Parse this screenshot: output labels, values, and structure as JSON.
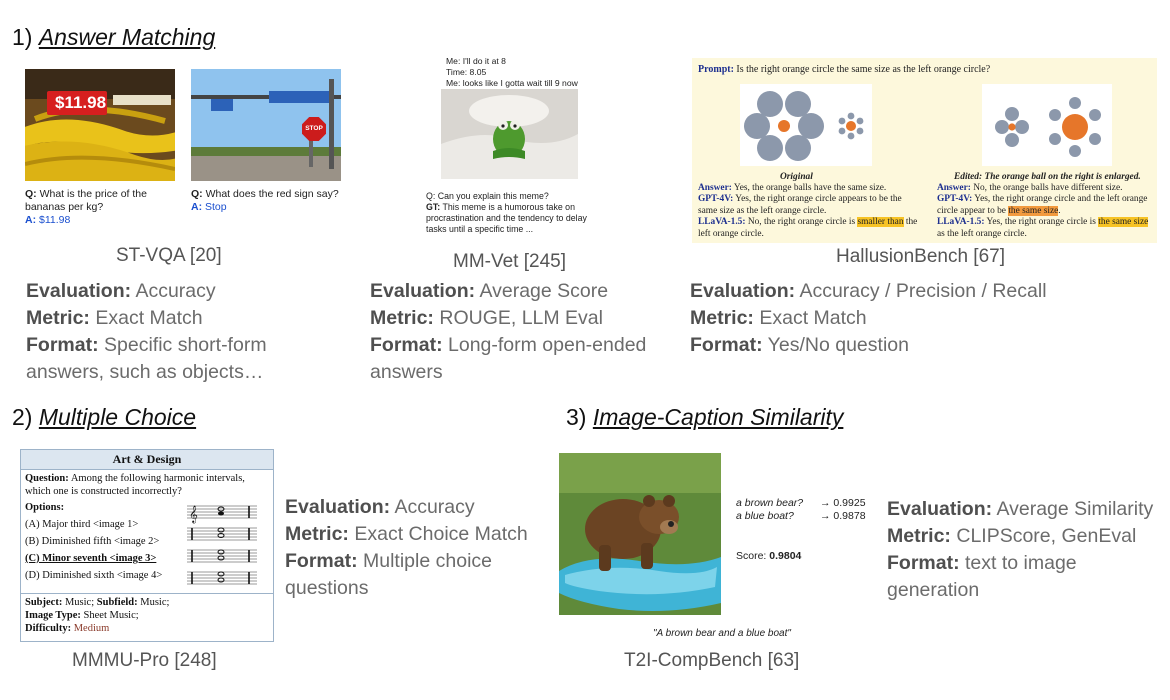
{
  "sections": {
    "s1": {
      "num": "1)",
      "label": "Answer Matching"
    },
    "s2": {
      "num": "2)",
      "label": "Multiple Choice"
    },
    "s3": {
      "num": "3)",
      "label": "Image-Caption Similarity"
    }
  },
  "stvqa": {
    "price_tag": "$11.98",
    "sign_text": "STOP",
    "q1": {
      "q_label": "Q:",
      "q": "What is the price of the bananas per kg?",
      "a_label": "A:",
      "a": "$11.98"
    },
    "q2": {
      "q_label": "Q:",
      "q": "What does the red sign say?",
      "a_label": "A:",
      "a": "Stop"
    },
    "caption": "ST-VQA [20]",
    "eval": {
      "label": "Evaluation:",
      "value": "Accuracy"
    },
    "metric": {
      "label": "Metric:",
      "value": "Exact Match"
    },
    "format": {
      "label": "Format:",
      "value": "Specific short-form answers, such as objects…"
    }
  },
  "mmvet": {
    "me1": "Me: I'll do it at 8",
    "time": "Time: 8.05",
    "me2": "Me: looks like I gotta wait till 9 now",
    "q": "Q: Can you explain this meme?",
    "gt_label": "GT:",
    "gt": "This meme is a humorous take on procrastination and the tendency to delay tasks until a specific time ...",
    "caption": "MM-Vet [245]",
    "eval": {
      "label": "Evaluation:",
      "value": "Average Score"
    },
    "metric": {
      "label": "Metric:",
      "value": "ROUGE, LLM Eval"
    },
    "format": {
      "label": "Format:",
      "value": "Long-form open-ended answers"
    }
  },
  "hallusion": {
    "prompt_label": "Prompt:",
    "prompt": "Is the right orange circle the same size as the left orange circle?",
    "orig_title": "Original",
    "edit_title": "Edited: The orange ball on the right is enlarged.",
    "left": {
      "answer_label": "Answer:",
      "answer": "Yes, the orange balls have the same size.",
      "gpt_label": "GPT-4V:",
      "gpt": "Yes, the right orange circle appears to be the same size as the left orange circle.",
      "llava_label": "LLaVA-1.5:",
      "llava_a": "No, the right orange circle is",
      "llava_hl": "smaller than",
      "llava_b": "the left orange circle."
    },
    "right": {
      "answer_label": "Answer:",
      "answer": "No, the orange balls have different size.",
      "gpt_label": "GPT-4V:",
      "gpt_a": "Yes, the right orange circle and the left orange circle appear to be",
      "gpt_hl": "the same size",
      "gpt_b": ".",
      "llava_label": "LLaVA-1.5:",
      "llava_a": "Yes, the right orange circle is",
      "llava_hl": "the same size",
      "llava_b": "as the left orange circle."
    },
    "caption": "HallusionBench [67]",
    "eval": {
      "label": "Evaluation:",
      "value": "Accuracy / Precision / Recall"
    },
    "metric": {
      "label": "Metric:",
      "value": "Exact Match"
    },
    "format": {
      "label": "Format:",
      "value": "Yes/No question"
    }
  },
  "mmmu": {
    "header": "Art & Design",
    "q_label": "Question:",
    "q": "Among the following harmonic intervals, which one is constructed incorrectly?",
    "options_label": "Options:",
    "opt_a": "(A) Major third <image 1>",
    "opt_b": "(B) Diminished fifth <image 2>",
    "opt_c": "(C) Minor seventh <image 3>",
    "opt_d": "(D) Diminished sixth <image 4>",
    "subject_label": "Subject:",
    "subject": "Music;",
    "subfield_label": "Subfield:",
    "subfield": "Music;",
    "type_label": "Image Type:",
    "type": "Sheet Music;",
    "diff_label": "Difficulty:",
    "diff": "Medium",
    "caption": "MMMU-Pro [248]",
    "eval": {
      "label": "Evaluation:",
      "value": "Accuracy"
    },
    "metric": {
      "label": "Metric:",
      "value": "Exact Choice Match"
    },
    "format": {
      "label": "Format:",
      "value": "Multiple choice questions"
    }
  },
  "t2i": {
    "q1": "a brown bear?",
    "s1": "→ 0.9925",
    "q2": "a blue boat?",
    "s2": "→ 0.9878",
    "score_label": "Score:",
    "score": "0.9804",
    "prompt": "\"A brown bear and a blue boat\"",
    "caption": "T2I-CompBench [63]",
    "eval": {
      "label": "Evaluation:",
      "value": "Average Similarity"
    },
    "metric": {
      "label": "Metric:",
      "value": "CLIPScore, GenEval"
    },
    "format": {
      "label": "Format:",
      "value": "text to image generation"
    }
  },
  "colors": {
    "orange": "#e6762a",
    "grey_circle": "#8c98ab",
    "panel_yellow": "#fdf8dc",
    "answer_blue": "#1a4fcf",
    "highlight": "#f7c325"
  }
}
